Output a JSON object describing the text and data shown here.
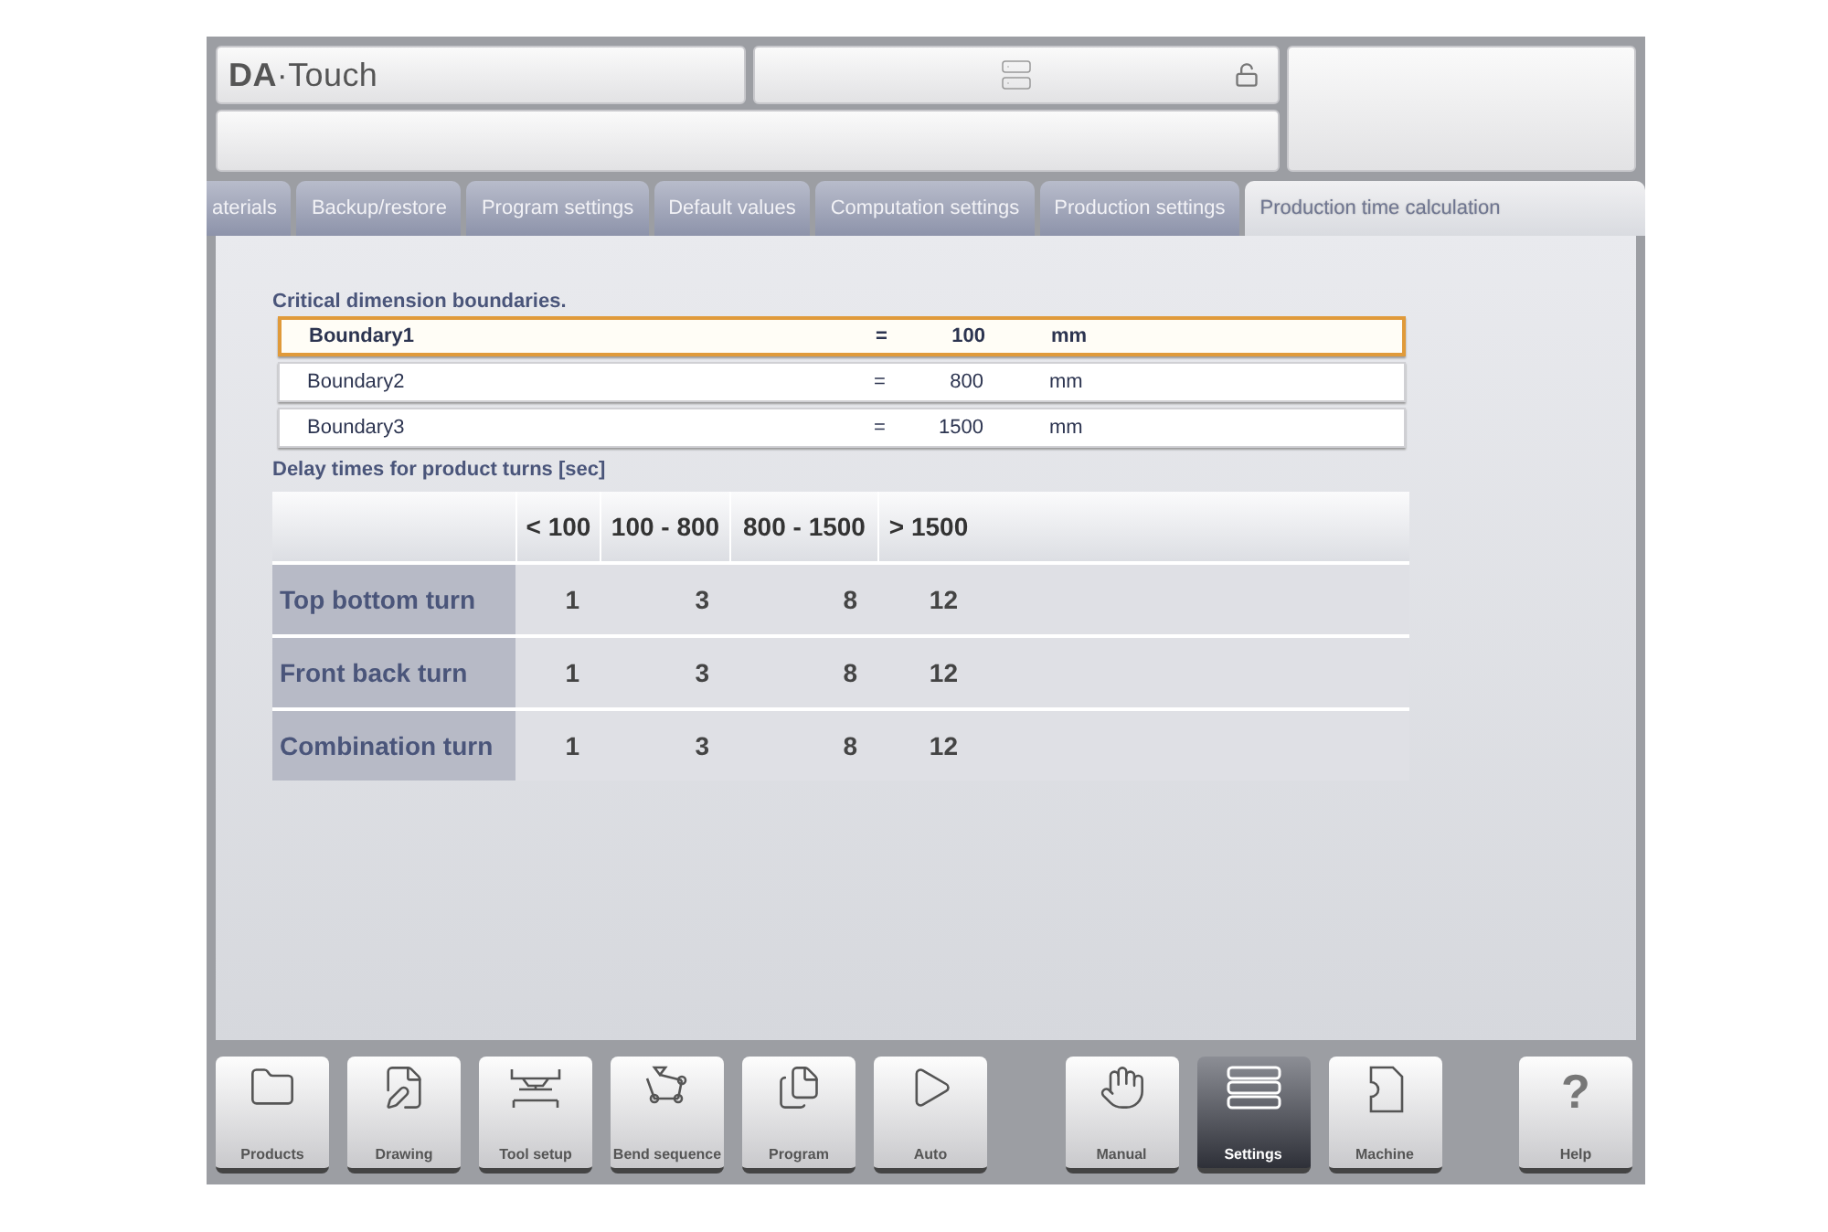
{
  "header": {
    "logo": "**DA**·Touch",
    "locked": false
  },
  "tabs": [
    {
      "label": "aterials",
      "selected": false
    },
    {
      "label": "Backup/restore",
      "selected": false
    },
    {
      "label": "Program settings",
      "selected": false
    },
    {
      "label": "Default values",
      "selected": false
    },
    {
      "label": "Computation settings",
      "selected": false
    },
    {
      "label": "Production settings",
      "selected": false
    },
    {
      "label": "Production time calculation",
      "selected": true
    }
  ],
  "boundaries": {
    "title": "Critical dimension boundaries.",
    "rows": [
      {
        "name": "Boundary1",
        "sign": "=",
        "value": "100",
        "unit": "mm",
        "selected": true
      },
      {
        "name": "Boundary2",
        "sign": "=",
        "value": "800",
        "unit": "mm",
        "selected": false
      },
      {
        "name": "Boundary3",
        "sign": "=",
        "value": "1500",
        "unit": "mm",
        "selected": false
      }
    ]
  },
  "delay_table": {
    "title": "Delay times for product turns [sec]",
    "columns": [
      "< 100",
      "100 - 800",
      "800 - 1500",
      "> 1500"
    ],
    "rows": [
      {
        "label": "Top bottom turn",
        "values": [
          "1",
          "3",
          "8",
          "12"
        ]
      },
      {
        "label": "Front back turn",
        "values": [
          "1",
          "3",
          "8",
          "12"
        ]
      },
      {
        "label": "Combination turn",
        "values": [
          "1",
          "3",
          "8",
          "12"
        ]
      }
    ]
  },
  "nav_groups": [
    [
      {
        "label": "Products",
        "kind": "folder",
        "selected": false
      },
      {
        "label": "Drawing",
        "kind": "drawing",
        "selected": false
      },
      {
        "label": "Tool setup",
        "kind": "tool",
        "selected": false
      },
      {
        "label": "Bend sequence",
        "kind": "bend",
        "selected": false
      },
      {
        "label": "Program",
        "kind": "pages",
        "selected": false
      },
      {
        "label": "Auto",
        "kind": "play",
        "selected": false
      }
    ],
    [
      {
        "label": "Manual",
        "kind": "hand",
        "selected": false
      },
      {
        "label": "Settings",
        "kind": "list",
        "selected": true
      },
      {
        "label": "Machine",
        "kind": "machine",
        "selected": false
      }
    ],
    [
      {
        "label": "Help",
        "kind": "help",
        "icon_char": "?",
        "selected": false
      }
    ]
  ]
}
